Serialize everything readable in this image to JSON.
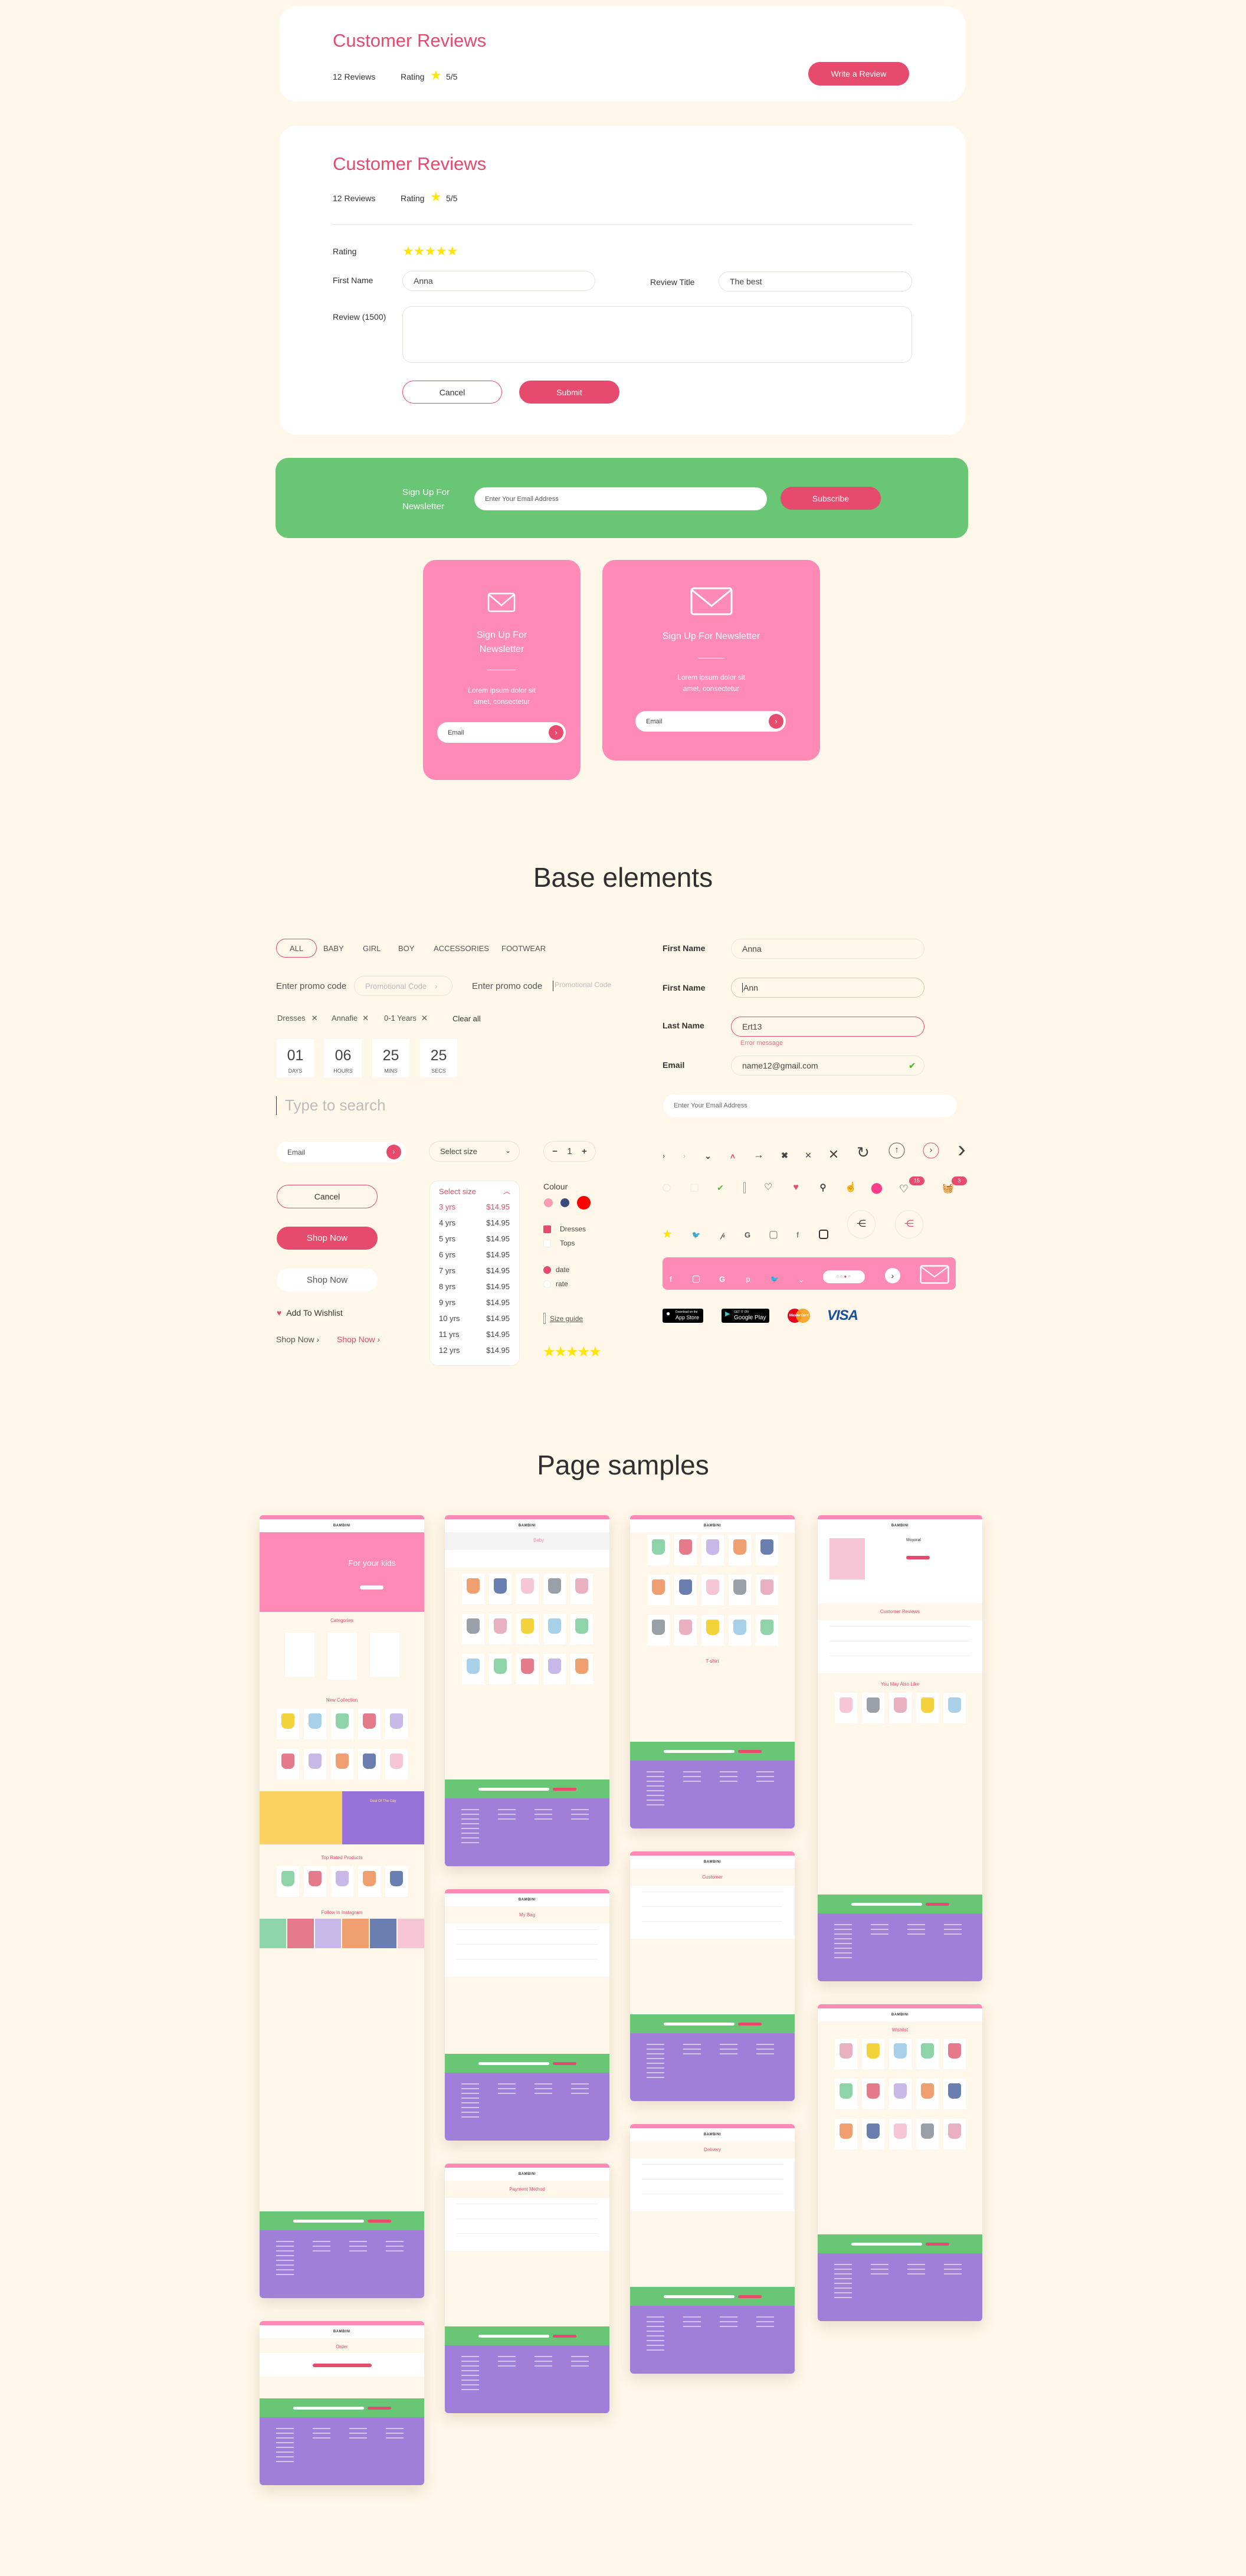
{
  "colors": {
    "background": "#fff7ea",
    "accent": "#e64a6d",
    "pink": "#ff8ab5",
    "green": "#69c674",
    "purple": "#a07fd8",
    "star": "#ffe600"
  },
  "reviews_summary": {
    "title": "Customer Reviews",
    "count": "12 Reviews",
    "rating_label": "Rating",
    "rating_value": "5/5",
    "write_button": "Write a Review"
  },
  "review_form": {
    "title": "Customer Reviews",
    "count": "12 Reviews",
    "rating_label": "Rating",
    "rating_value": "5/5",
    "stars_label": "Rating",
    "stars": 5,
    "first_name_label": "First Name",
    "first_name_value": "Anna",
    "review_title_label": "Review Title",
    "review_title_value": "The best",
    "review_label": "Review (1500)",
    "cancel": "Cancel",
    "submit": "Submit"
  },
  "newsletter_bar": {
    "label_line1": "Sign Up For",
    "label_line2": "Newsletter",
    "placeholder": "Enter Your Email Address",
    "button": "Subscribe"
  },
  "newsletter_small": {
    "title_line1": "Sign Up For",
    "title_line2": "Newsletter",
    "text_line1": "Lorem ipsum dolor sit",
    "text_line2": "amet, consectetur",
    "placeholder": "Email"
  },
  "newsletter_large": {
    "title": "Sign Up For Newsletter",
    "text_line1": "Lorem ipsum dolor sit",
    "text_line2": "amet, consectetur",
    "placeholder": "Email"
  },
  "base": {
    "heading": "Base elements",
    "tabs": [
      "ALL",
      "BABY",
      "GIRL",
      "BOY",
      "ACCESSORIES",
      "FOOTWEAR"
    ],
    "active_tab": "ALL",
    "promo_label": "Enter promo code",
    "promo_placeholder": "Promotional Code",
    "filters": [
      "Dresses",
      "Annafie",
      "0-1 Years"
    ],
    "clear_all": "Clear all",
    "countdown": [
      {
        "value": "01",
        "unit": "DAYS"
      },
      {
        "value": "06",
        "unit": "HOURS"
      },
      {
        "value": "25",
        "unit": "MINS"
      },
      {
        "value": "25",
        "unit": "SECS"
      }
    ],
    "search_placeholder": "Type to search",
    "email_placeholder": "Email",
    "select_size": "Select size",
    "quantity": "1",
    "cancel": "Cancel",
    "shop_now": "Shop Now",
    "wishlist": "Add To Wishlist",
    "sizes": [
      {
        "size": "3 yrs",
        "price": "$14.95",
        "hover": true
      },
      {
        "size": "4 yrs",
        "price": "$14.95"
      },
      {
        "size": "5 yrs",
        "price": "$14.95"
      },
      {
        "size": "6 yrs",
        "price": "$14.95"
      },
      {
        "size": "7 yrs",
        "price": "$14.95"
      },
      {
        "size": "8 yrs",
        "price": "$14.95"
      },
      {
        "size": "9 yrs",
        "price": "$14.95"
      },
      {
        "size": "10 yrs",
        "price": "$14.95"
      },
      {
        "size": "11 yrs",
        "price": "$14.95"
      },
      {
        "size": "12 yrs",
        "price": "$14.95"
      }
    ],
    "colour_label": "Colour",
    "colours": [
      "#ff9bb0",
      "#3a4a7c",
      "#ff0000"
    ],
    "checkboxes": [
      {
        "label": "Dresses",
        "checked": true
      },
      {
        "label": "Tops",
        "checked": false
      }
    ],
    "radios": [
      {
        "label": "date",
        "checked": true
      },
      {
        "label": "rate",
        "checked": false
      }
    ],
    "size_guide": "Size guide",
    "form": {
      "first_name_label": "First Name",
      "first_name_value": "Anna",
      "first_name_label2": "First Name",
      "first_name_value2": "Ann",
      "last_name_label": "Last Name",
      "last_name_value": "Ert13",
      "error": "Error message",
      "email_label": "Email",
      "email_value": "name12@gmail.com",
      "email_placeholder": "Enter Your Email Address"
    },
    "badges": {
      "wishlist": "15",
      "cart": "3"
    },
    "stores": {
      "apple_small": "Download on the",
      "apple": "App Store",
      "google_small": "GET IT ON",
      "google": "Google Play",
      "mastercard": "MasterCard",
      "visa": "VISA"
    }
  },
  "samples": {
    "heading": "Page samples",
    "logo": "BAMBINI",
    "pages": [
      {
        "title": "For your kids",
        "sections": [
          "hero",
          "Categories",
          "cats",
          "New Collection",
          "grid",
          "grid",
          "deal",
          "Top Rated Products",
          "grid",
          "Follow In Instagram",
          "insta"
        ],
        "deal": "Deal Of The Day"
      },
      {
        "title": "Baby",
        "sections": [
          "banner",
          "filters",
          "grid",
          "grid",
          "grid"
        ]
      },
      {
        "title": "My Bag",
        "sections": [
          "t",
          "list"
        ]
      },
      {
        "title": "Payment Method",
        "sections": [
          "t",
          "list"
        ]
      },
      {
        "title": "T-shirt",
        "sections": [
          "grid",
          "grid",
          "grid"
        ]
      },
      {
        "title": "Customer",
        "sections": [
          "t",
          "list"
        ]
      },
      {
        "title": "Delivery",
        "sections": [
          "t",
          "list"
        ]
      },
      {
        "title": "Moyoral",
        "sections": [
          "product",
          "Customer Reviews",
          "list",
          "You May Also Like",
          "grid"
        ]
      },
      {
        "title": "Wishlist",
        "sections": [
          "t",
          "grid",
          "grid",
          "grid"
        ]
      },
      {
        "title": "Order",
        "sections": [
          "t",
          "order"
        ]
      }
    ]
  }
}
